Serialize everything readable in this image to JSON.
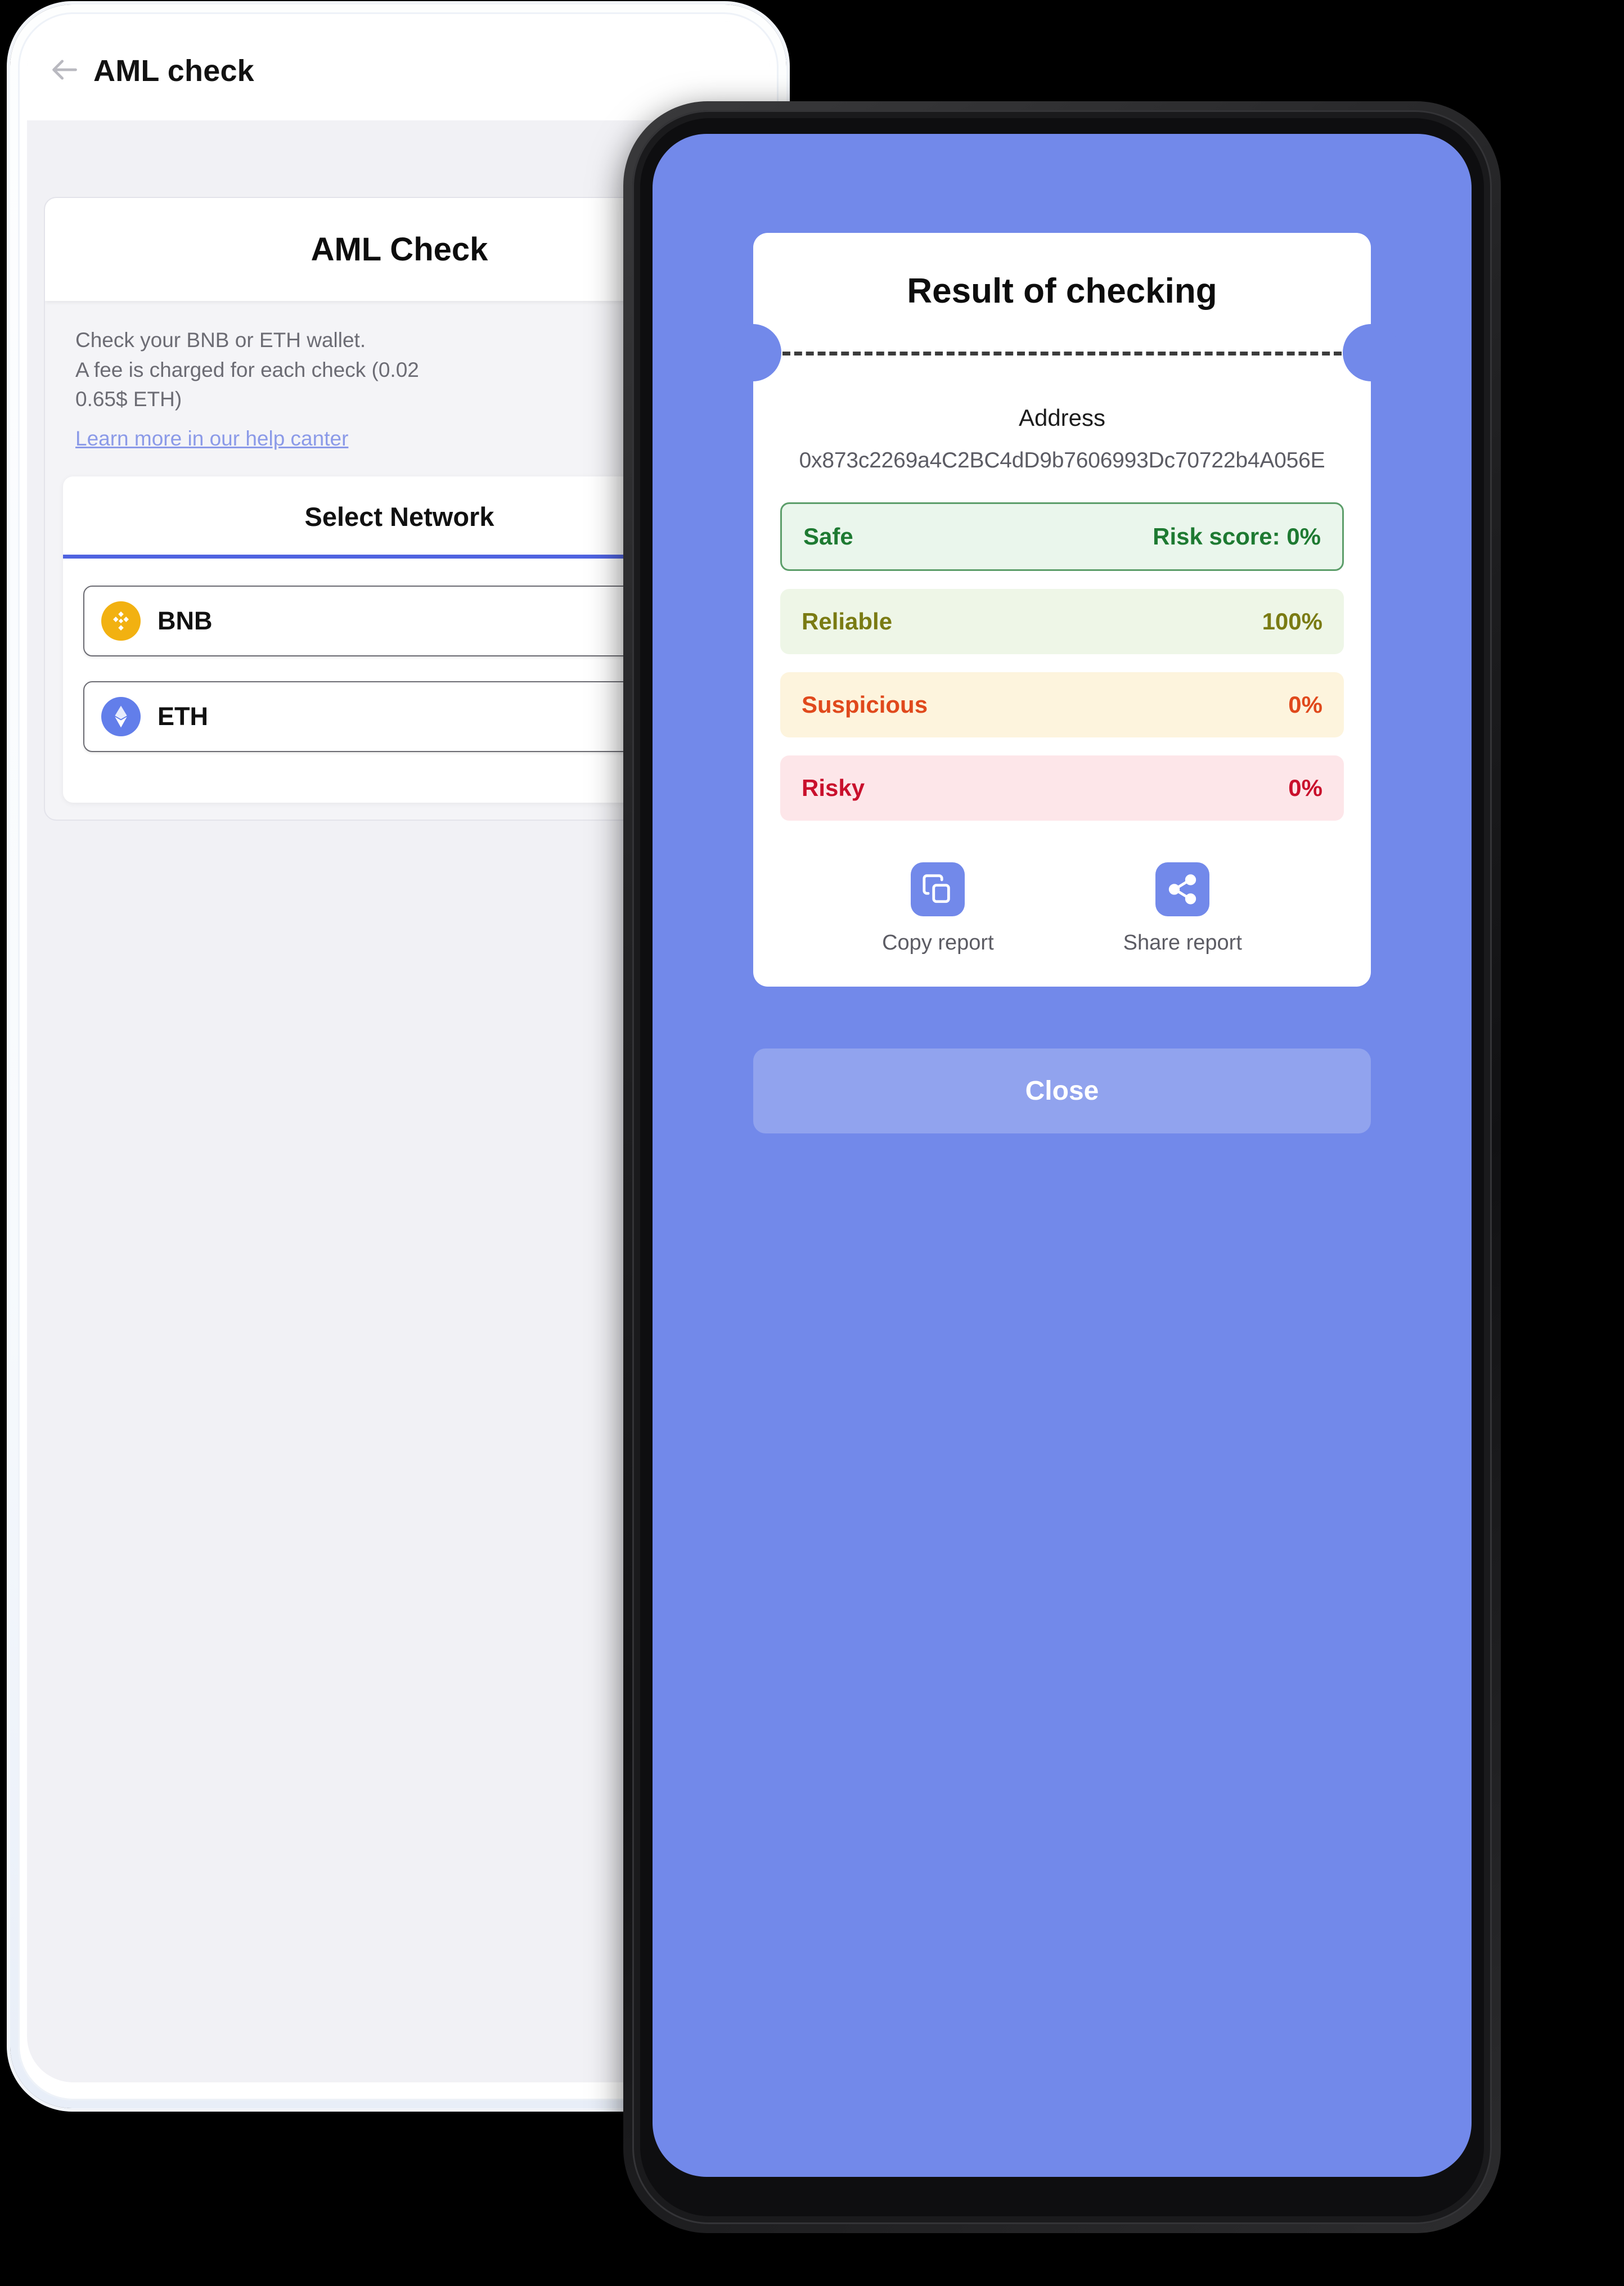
{
  "left_phone": {
    "appbar": {
      "back_icon": "arrow-left-icon",
      "title": "AML check"
    },
    "card": {
      "title": "AML Check",
      "description_line1": "Check your BNB or ETH wallet.",
      "description_line2": "A fee is charged for each check (0.02",
      "description_line3": "0.65$ ETH)",
      "help_link": "Learn more in our help canter"
    },
    "network_card": {
      "title": "Select Network",
      "options": [
        {
          "label": "BNB",
          "icon": "bnb-coin-icon",
          "color": "#f2b111"
        },
        {
          "label": "ETH",
          "icon": "eth-coin-icon",
          "color": "#627eea"
        }
      ]
    }
  },
  "right_phone": {
    "screen_color": "#7289ea",
    "dialog": {
      "title": "Result of checking",
      "address_label": "Address",
      "address_value": "0x873c2269a4C2BC4dD9b7606993Dc70722b4A056E",
      "scores": [
        {
          "label": "Safe",
          "value": "Risk score: 0%",
          "text_color": "#1e7a32",
          "bg_color": "#eaf6ec",
          "border_color": "#5c9e6a"
        },
        {
          "label": "Reliable",
          "value": "100%",
          "text_color": "#7a7b13",
          "bg_color": "#eef6e7",
          "border_color": ""
        },
        {
          "label": "Suspicious",
          "value": "0%",
          "text_color": "#e0491c",
          "bg_color": "#fdf4dd",
          "border_color": ""
        },
        {
          "label": "Risky",
          "value": "0%",
          "text_color": "#c9102c",
          "bg_color": "#fde6e9",
          "border_color": ""
        }
      ],
      "actions": [
        {
          "label": "Copy report",
          "icon": "copy-icon"
        },
        {
          "label": "Share report",
          "icon": "share-icon"
        }
      ]
    },
    "close_button": "Close"
  }
}
